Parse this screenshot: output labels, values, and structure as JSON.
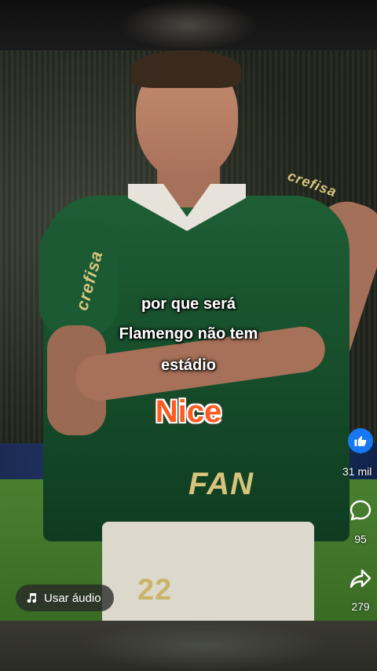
{
  "caption": {
    "line1": "por que será",
    "line2": "Flamengo não tem",
    "line3": "estádio"
  },
  "sticker": "Nice",
  "jersey": {
    "sponsor_chest": "FAN",
    "sponsor_sleeve": "crefisa",
    "sponsor_shoulder": "crefisa",
    "number": "22"
  },
  "actions": {
    "likes": "31 mil",
    "comments": "95",
    "shares": "279"
  },
  "audio_button": {
    "label": "Usar áudio",
    "icon": "music-note-icon"
  },
  "colors": {
    "like_blue": "#1877f2",
    "sticker_orange": "#ff5a1f",
    "jersey_green": "#1e5e35"
  }
}
